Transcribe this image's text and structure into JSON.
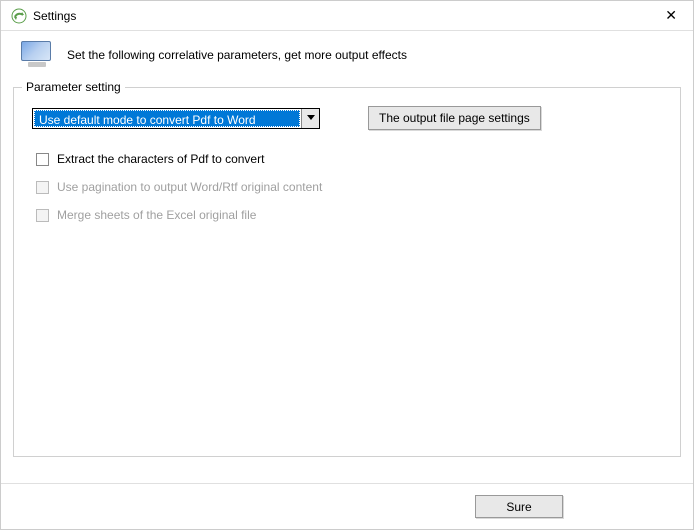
{
  "window": {
    "title": "Settings"
  },
  "header": {
    "description": "Set the following correlative parameters, get more output effects"
  },
  "groupbox": {
    "legend": "Parameter setting",
    "dropdown_selected": "Use default mode to convert Pdf to Word",
    "output_settings_button": "The output file page settings",
    "checkboxes": [
      {
        "label": "Extract the characters of Pdf to convert",
        "enabled": true,
        "checked": false
      },
      {
        "label": "Use pagination to output Word/Rtf original content",
        "enabled": false,
        "checked": false
      },
      {
        "label": "Merge sheets of the Excel original file",
        "enabled": false,
        "checked": false
      }
    ]
  },
  "footer": {
    "confirm_button": "Sure"
  }
}
